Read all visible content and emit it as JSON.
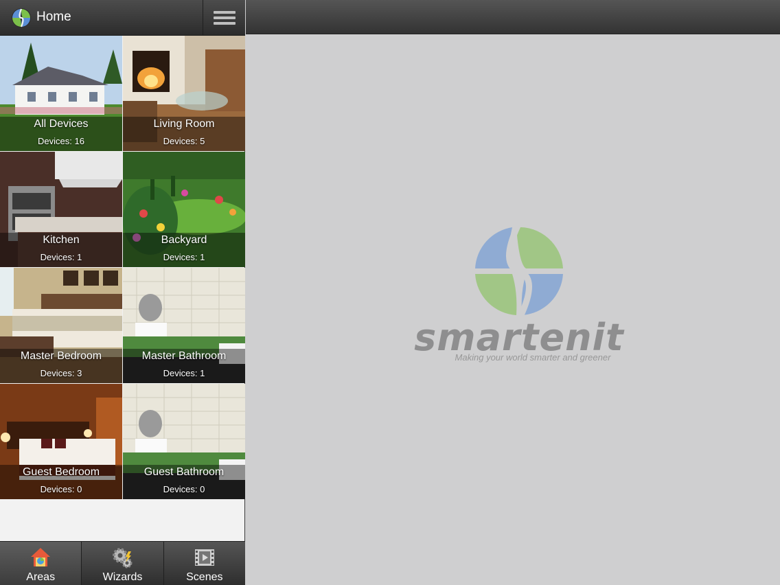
{
  "header": {
    "title": "Home"
  },
  "areas": [
    {
      "name": "All Devices",
      "devices": "Devices: 16"
    },
    {
      "name": "Living Room",
      "devices": "Devices: 5"
    },
    {
      "name": "Kitchen",
      "devices": "Devices: 1"
    },
    {
      "name": "Backyard",
      "devices": "Devices: 1"
    },
    {
      "name": "Master Bedroom",
      "devices": "Devices: 3"
    },
    {
      "name": "Master Bathroom",
      "devices": "Devices: 1"
    },
    {
      "name": "Guest Bedroom",
      "devices": "Devices: 0"
    },
    {
      "name": "Guest Bathroom",
      "devices": "Devices: 0"
    }
  ],
  "tabs": [
    {
      "label": "Areas",
      "icon": "house-icon",
      "active": true
    },
    {
      "label": "Wizards",
      "icon": "gears-icon",
      "active": false
    },
    {
      "label": "Scenes",
      "icon": "film-icon",
      "active": false
    }
  ],
  "watermark": {
    "brand": "smartenit",
    "tagline": "Making your world smarter and greener"
  },
  "colors": {
    "accent_blue": "#5b8fd6",
    "accent_green": "#7cc04a",
    "bar_dark": "#333333"
  }
}
